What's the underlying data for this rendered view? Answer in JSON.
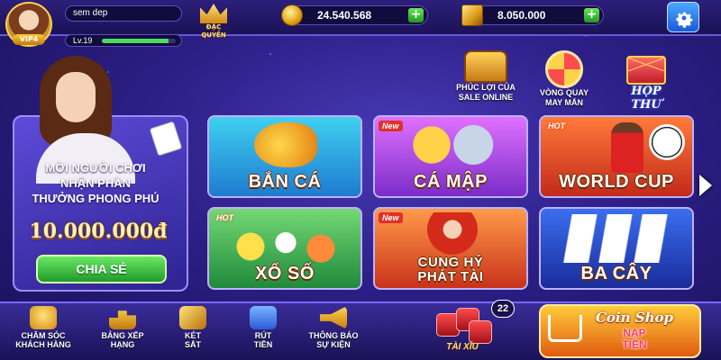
{
  "user": {
    "name": "sem dep",
    "vip": "VIP4",
    "level": "Lv.19",
    "level_progress": 0.9,
    "privilege_line1": "ĐẶC",
    "privilege_line2": "QUYỀN"
  },
  "wallet": {
    "coin": "24.540.568",
    "gold": "8.050.000"
  },
  "promo": {
    "line1": "MỜI NGƯỜI CHƠI",
    "line2": "NHẬN PHẦN",
    "line3": "THƯỞNG PHONG PHÚ",
    "amount": "10.000.000đ",
    "share_button": "CHIA SẺ"
  },
  "features": {
    "sale_line1": "PHÚC LỢI CỦA",
    "sale_line2": "SALE ONLINE",
    "spin_line1": "VÒNG QUAY",
    "spin_line2": "MAY MẮN",
    "mailbox": "HỘP THƯ"
  },
  "games": [
    {
      "title": "BẮN CÁ",
      "badge": ""
    },
    {
      "title": "CÁ MẬP",
      "badge": "New"
    },
    {
      "title": "WORLD CUP",
      "badge": "HOT"
    },
    {
      "title": "XỔ SỐ",
      "badge": "HOT"
    },
    {
      "title_line1": "CUNG HỶ",
      "title_line2": "PHÁT TÀI",
      "badge": "New"
    },
    {
      "title": "BA CÂY",
      "badge": ""
    }
  ],
  "nav": [
    {
      "line1": "CHĂM SÓC",
      "line2": "KHÁCH HÀNG",
      "icon": "headset-icon"
    },
    {
      "line1": "BẢNG XẾP",
      "line2": "HẠNG",
      "icon": "podium-icon"
    },
    {
      "line1": "KÉT",
      "line2": "SẮT",
      "icon": "safe-icon"
    },
    {
      "line1": "RÚT",
      "line2": "TIỀN",
      "icon": "withdraw-icon"
    },
    {
      "line1": "THÔNG BÁO",
      "line2": "SỰ KIỆN",
      "icon": "megaphone-icon"
    }
  ],
  "taixiu": {
    "label": "TÀI XỈU",
    "count": "22"
  },
  "coinshop": {
    "line1": "Coin Shop",
    "line2": "NẠP",
    "line3": "TIỀN"
  },
  "colors": {
    "accent": "#6a58e0",
    "background": "#2c1f86",
    "gold": "#ffd34a",
    "plus": "#1e9a1e"
  }
}
